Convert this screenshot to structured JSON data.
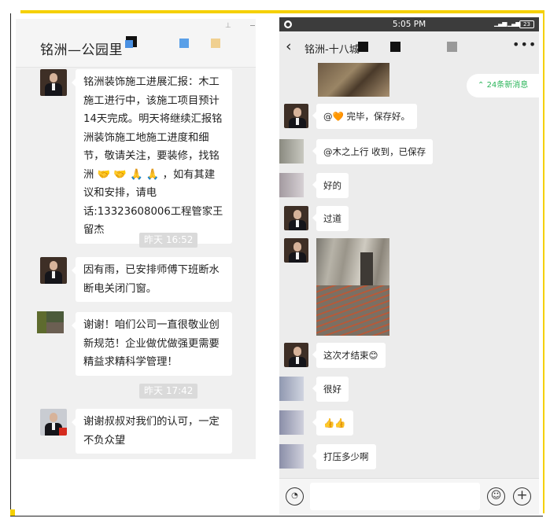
{
  "left_chat": {
    "title": "铭洲—公园里",
    "messages": [
      {
        "text": "铭洲装饰施工进展汇报：木工施工进行中，该施工项目预计14天完成。明天将继续汇报铭洲装饰施工地施工进度和细节，敬请关注，要装修，找铭洲 🤝 🤝 🙏 🙏 ，如有其建议和安排，请电话:13323608006工程管家王留杰"
      },
      {
        "text": "因有雨，已安排师傅下班断水断电关闭门窗。"
      },
      {
        "text": "谢谢！咱们公司一直很敬业创新规范！企业做优做强更需要精益求精科学管理！"
      },
      {
        "text": "谢谢叔叔对我们的认可，一定不负众望"
      }
    ],
    "timestamps": [
      "昨天 16:52",
      "昨天 17:42"
    ]
  },
  "right_chat": {
    "status_time": "5:05 PM",
    "battery": "23",
    "title": "铭洲-十八城",
    "new_messages": "24条新消息",
    "messages": [
      {
        "text": "@🧡 完毕，保存好。"
      },
      {
        "text": "@木之上行 收到，已保存"
      },
      {
        "text": "好的"
      },
      {
        "text": "过道"
      },
      {
        "text": "这次才结束😊"
      },
      {
        "text": "很好"
      },
      {
        "text": "👍👍"
      },
      {
        "text": "打压多少啊"
      }
    ]
  },
  "colors": {
    "accent_yellow": "#f5d000",
    "wechat_green": "#2bb55a"
  },
  "icons": [
    "back-icon",
    "more-icon",
    "voice-icon",
    "emoji-icon",
    "plus-icon",
    "pin-icon"
  ]
}
